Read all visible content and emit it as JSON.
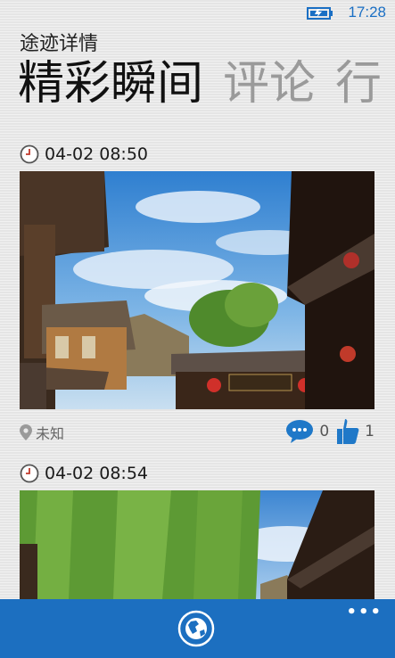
{
  "status": {
    "time": "17:28"
  },
  "app_title": "途迹详情",
  "pivot": [
    {
      "label": "精彩瞬间"
    },
    {
      "label": "评论"
    },
    {
      "label": "行"
    }
  ],
  "moments": [
    {
      "time": "04-02 08:50",
      "location": "未知",
      "comments": "0",
      "likes": "1"
    },
    {
      "time": "04-02 08:54"
    }
  ],
  "colors": {
    "accent": "#1c6fc0",
    "appbar": "#1c6fc0",
    "comment_icon": "#1f78c8",
    "like_icon": "#1f78c8"
  },
  "icons": [
    "battery-icon",
    "clock-icon",
    "location-pin-icon",
    "comment-icon",
    "thumbs-up-icon",
    "globe-icon",
    "more-icon"
  ]
}
